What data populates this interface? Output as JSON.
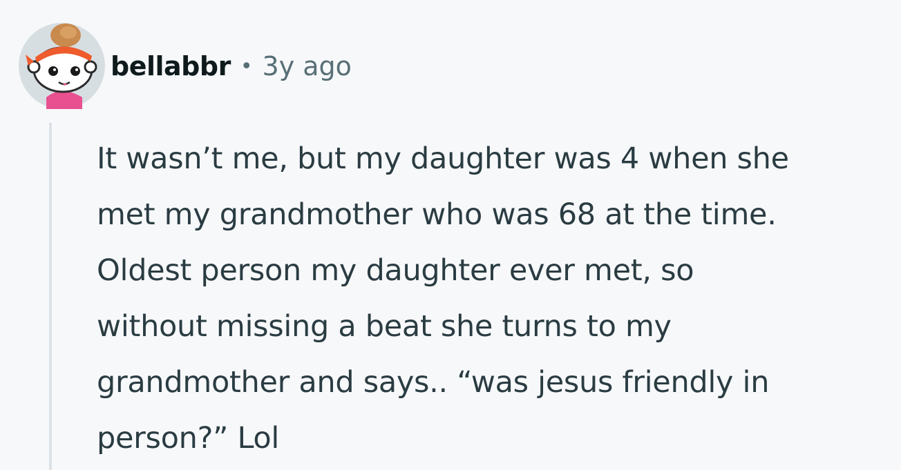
{
  "comment": {
    "author": "bellabbr",
    "separator": "•",
    "age": "3y ago",
    "avatar_icon": "snoo-avatar-icon",
    "body_lines": [
      "It wasn’t me, but my daughter was 4 when she",
      "met my grandmother who was 68 at the time.",
      "Oldest person my daughter ever met, so",
      "without missing a beat she turns to my",
      "grandmother and says.. “was jesus friendly in",
      "person?” Lol"
    ]
  },
  "colors": {
    "background": "#f7f8fa",
    "author": "#0f1a1c",
    "meta": "#576f76",
    "body": "#2a3c42",
    "thread_line": "#dbe1e5"
  }
}
